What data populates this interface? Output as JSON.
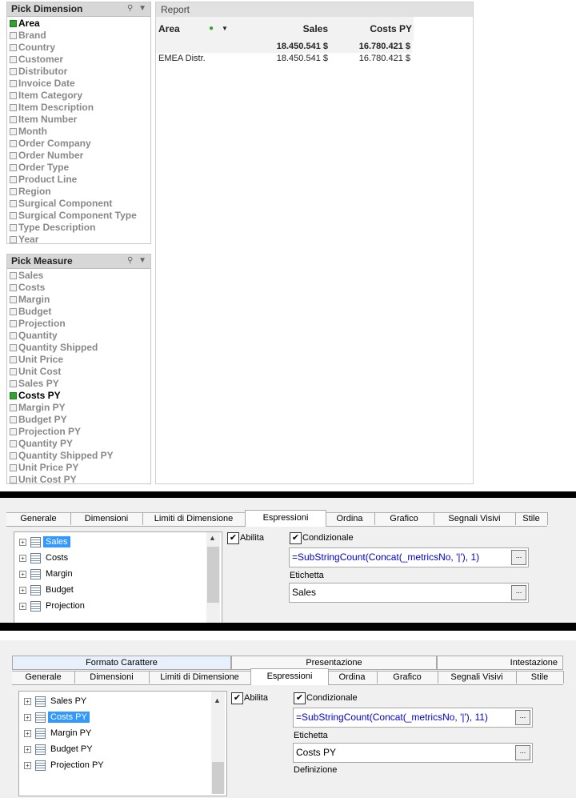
{
  "pick_dimension": {
    "title": "Pick Dimension",
    "items": [
      {
        "label": "Area",
        "selected": true
      },
      {
        "label": "Brand",
        "selected": false
      },
      {
        "label": "Country",
        "selected": false
      },
      {
        "label": "Customer",
        "selected": false
      },
      {
        "label": "Distributor",
        "selected": false
      },
      {
        "label": "Invoice Date",
        "selected": false
      },
      {
        "label": "Item Category",
        "selected": false
      },
      {
        "label": "Item Description",
        "selected": false
      },
      {
        "label": "Item Number",
        "selected": false
      },
      {
        "label": "Month",
        "selected": false
      },
      {
        "label": "Order Company",
        "selected": false
      },
      {
        "label": "Order Number",
        "selected": false
      },
      {
        "label": "Order Type",
        "selected": false
      },
      {
        "label": "Product Line",
        "selected": false
      },
      {
        "label": "Region",
        "selected": false
      },
      {
        "label": "Surgical Component",
        "selected": false
      },
      {
        "label": "Surgical Component Type",
        "selected": false
      },
      {
        "label": "Type Description",
        "selected": false
      },
      {
        "label": "Year",
        "selected": false
      }
    ]
  },
  "pick_measure": {
    "title": "Pick Measure",
    "items": [
      {
        "label": "Sales",
        "selected": false
      },
      {
        "label": "Costs",
        "selected": false
      },
      {
        "label": "Margin",
        "selected": false
      },
      {
        "label": "Budget",
        "selected": false
      },
      {
        "label": "Projection",
        "selected": false
      },
      {
        "label": "Quantity",
        "selected": false
      },
      {
        "label": "Quantity Shipped",
        "selected": false
      },
      {
        "label": "Unit Price",
        "selected": false
      },
      {
        "label": "Unit Cost",
        "selected": false
      },
      {
        "label": "Sales PY",
        "selected": false
      },
      {
        "label": "Costs PY",
        "selected": true
      },
      {
        "label": "Margin PY",
        "selected": false
      },
      {
        "label": "Budget PY",
        "selected": false
      },
      {
        "label": "Projection PY",
        "selected": false
      },
      {
        "label": "Quantity PY",
        "selected": false
      },
      {
        "label": "Quantity Shipped PY",
        "selected": false
      },
      {
        "label": "Unit Price PY",
        "selected": false
      },
      {
        "label": "Unit Cost PY",
        "selected": false
      }
    ]
  },
  "report": {
    "title": "Report",
    "headers": {
      "area": "Area",
      "sales": "Sales",
      "costs_py": "Costs PY"
    },
    "total": {
      "sales": "18.450.541 $",
      "costs_py": "16.780.421 $"
    },
    "rows": [
      {
        "area": "EMEA Distr.",
        "sales": "18.450.541 $",
        "costs_py": "16.780.421 $"
      }
    ]
  },
  "dialog1": {
    "tabs": [
      "Generale",
      "Dimensioni",
      "Limiti di Dimensione",
      "Espressioni",
      "Ordina",
      "Grafico",
      "Segnali Visivi",
      "Stile"
    ],
    "active_tab": "Espressioni",
    "tree": [
      "Sales",
      "Costs",
      "Margin",
      "Budget",
      "Projection"
    ],
    "selected": "Sales",
    "abilita": "Abilita",
    "condizionale": "Condizionale",
    "formula": "=SubStringCount(Concat(_metricsNo, '|'), 1)",
    "etichetta_label": "Etichetta",
    "etichetta_value": "Sales"
  },
  "dialog2": {
    "top_tabs": [
      "Formato Carattere",
      "Presentazione",
      "Intestazione"
    ],
    "tabs": [
      "Generale",
      "Dimensioni",
      "Limiti di Dimensione",
      "Espressioni",
      "Ordina",
      "Grafico",
      "Segnali Visivi",
      "Stile"
    ],
    "active_tab": "Espressioni",
    "tree": [
      "Sales PY",
      "Costs PY",
      "Margin PY",
      "Budget PY",
      "Projection PY"
    ],
    "selected": "Costs PY",
    "abilita": "Abilita",
    "condizionale": "Condizionale",
    "formula": "=SubStringCount(Concat(_metricsNo, '|'), 11)",
    "etichetta_label": "Etichetta",
    "etichetta_value": "Costs PY",
    "definizione_label": "Definizione"
  },
  "icons": {
    "checkbox_checked": "✔",
    "ellipsis": "...",
    "expand": "+",
    "scroll_up": "▲",
    "dropdown": "▼",
    "pin": "⚲",
    "status_dot": "●"
  },
  "colors": {
    "selected_green": "#2fa52f",
    "tree_highlight": "#3399ff",
    "formula_blue": "#0000cc"
  }
}
